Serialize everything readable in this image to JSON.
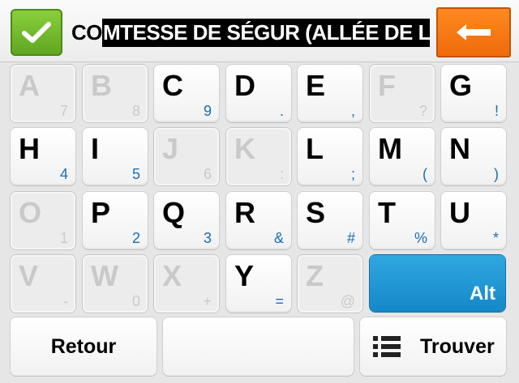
{
  "header": {
    "typed_text": "CO",
    "suggestion_text": "MTESSE DE SÉGUR (ALLÉE DE LA)",
    "ok_icon": "checkmark-icon",
    "back_icon": "arrow-left-icon",
    "colors": {
      "ok": "#6db52a",
      "back": "#f07812",
      "alt": "#1d95d3",
      "sub_label": "#1a6fb5"
    }
  },
  "keyboard": {
    "rows": [
      [
        {
          "main": "A",
          "sub": "7",
          "enabled": false
        },
        {
          "main": "B",
          "sub": "8",
          "enabled": false
        },
        {
          "main": "C",
          "sub": "9",
          "enabled": true
        },
        {
          "main": "D",
          "sub": ".",
          "enabled": true
        },
        {
          "main": "E",
          "sub": ",",
          "enabled": true
        },
        {
          "main": "F",
          "sub": "?",
          "enabled": false
        },
        {
          "main": "G",
          "sub": "!",
          "enabled": true
        }
      ],
      [
        {
          "main": "H",
          "sub": "4",
          "enabled": true
        },
        {
          "main": "I",
          "sub": "5",
          "enabled": true
        },
        {
          "main": "J",
          "sub": "6",
          "enabled": false
        },
        {
          "main": "K",
          "sub": ":",
          "enabled": false
        },
        {
          "main": "L",
          "sub": ";",
          "enabled": true
        },
        {
          "main": "M",
          "sub": "(",
          "enabled": true
        },
        {
          "main": "N",
          "sub": ")",
          "enabled": true
        }
      ],
      [
        {
          "main": "O",
          "sub": "1",
          "enabled": false
        },
        {
          "main": "P",
          "sub": "2",
          "enabled": true
        },
        {
          "main": "Q",
          "sub": "3",
          "enabled": true
        },
        {
          "main": "R",
          "sub": "&",
          "enabled": true
        },
        {
          "main": "S",
          "sub": "#",
          "enabled": true
        },
        {
          "main": "T",
          "sub": "%",
          "enabled": true
        },
        {
          "main": "U",
          "sub": "*",
          "enabled": true
        }
      ],
      [
        {
          "main": "V",
          "sub": "-",
          "enabled": false
        },
        {
          "main": "W",
          "sub": "0",
          "enabled": false
        },
        {
          "main": "X",
          "sub": "+",
          "enabled": false
        },
        {
          "main": "Y",
          "sub": "=",
          "enabled": true
        },
        {
          "main": "Z",
          "sub": "@",
          "enabled": false
        }
      ]
    ],
    "alt_label": "Alt"
  },
  "bottom": {
    "back_label": "Retour",
    "space_label": "",
    "find_label": "Trouver",
    "find_icon": "list-icon"
  }
}
